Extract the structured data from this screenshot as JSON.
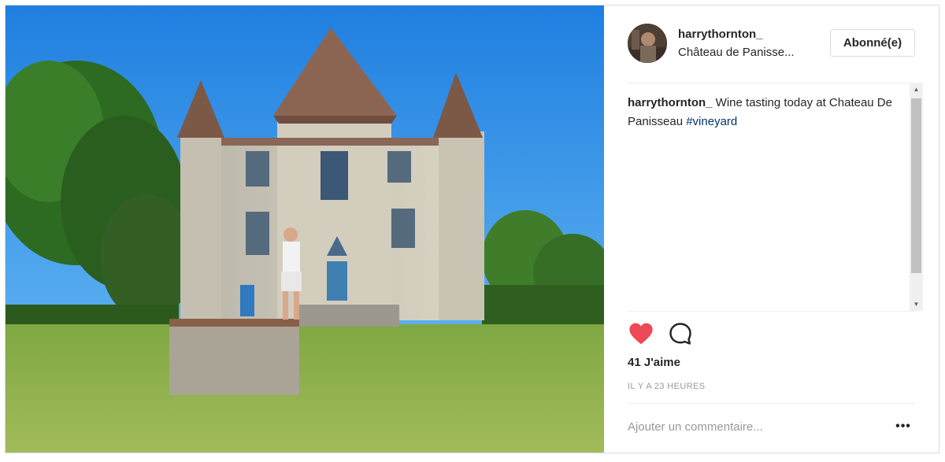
{
  "post": {
    "author": "harrythornton_",
    "location": "Château de Panisse...",
    "follow_label": "Abonné(e)",
    "caption_user": "harrythornton_",
    "caption_text": " Wine tasting today at Chateau De Panisseau ",
    "hashtag": "#vineyard",
    "likes": "41 J'aime",
    "time_ago": "IL Y A 23 HEURES",
    "comment_placeholder": "Ajouter un commentaire...",
    "more_label": "•••"
  },
  "icons": {
    "like": "heart-icon",
    "comment": "comment-bubble-icon",
    "more": "more-options-icon",
    "scroll_up": "arrow-up-icon",
    "scroll_down": "arrow-down-icon"
  },
  "colors": {
    "like_red": "#ed4956",
    "hashtag_blue": "#003569",
    "muted_text": "#999999",
    "border": "#dbdbdb"
  }
}
